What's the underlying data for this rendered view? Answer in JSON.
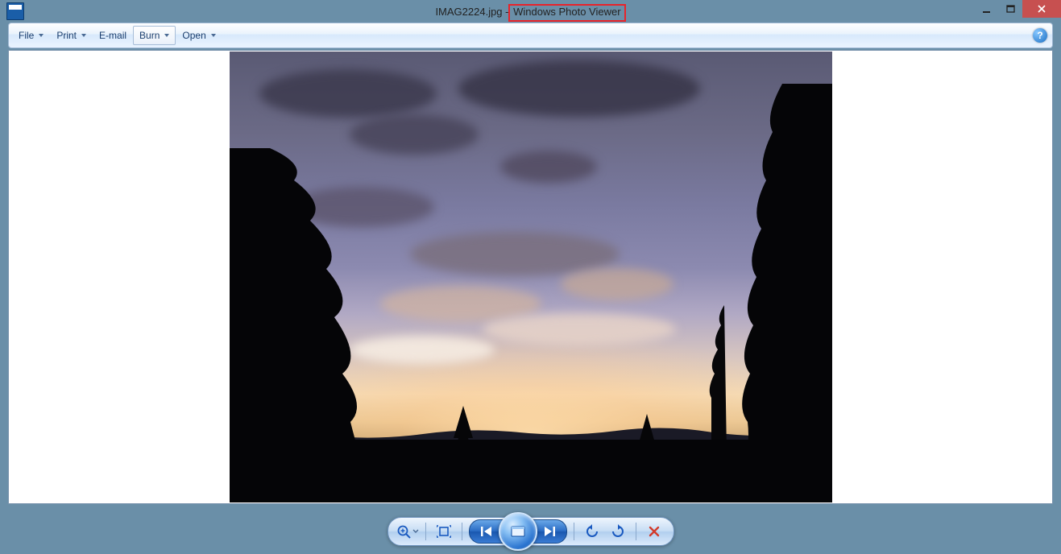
{
  "title": {
    "filename": "IMAG2224.jpg",
    "separator": " - ",
    "appname": "Windows Photo Viewer"
  },
  "menu": {
    "file": "File",
    "print": "Print",
    "email": "E-mail",
    "burn": "Burn",
    "open": "Open"
  },
  "icons": {
    "minimize": "minimize",
    "maximize": "maximize",
    "close": "close",
    "help": "?",
    "zoom": "zoom",
    "fit": "fit-window",
    "prev": "previous",
    "play": "slideshow",
    "next": "next",
    "rotate_ccw": "rotate-left",
    "rotate_cw": "rotate-right",
    "delete": "delete"
  }
}
